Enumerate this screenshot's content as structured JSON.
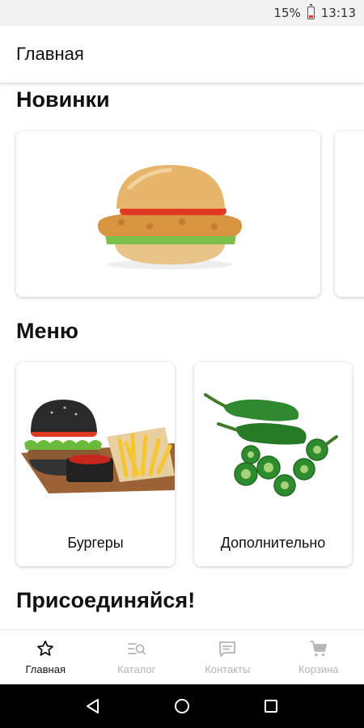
{
  "status_bar": {
    "battery_percent": "15%",
    "time": "13:13"
  },
  "app_bar": {
    "title": "Главная"
  },
  "sections": {
    "new": {
      "title": "Новинки"
    },
    "menu": {
      "title": "Меню",
      "items": [
        {
          "label": "Бургеры"
        },
        {
          "label": "Дополнительно"
        }
      ]
    },
    "join": {
      "title": "Присоединяйся!"
    }
  },
  "bottom_nav": {
    "items": [
      {
        "label": "Главная",
        "icon": "star-icon",
        "active": true
      },
      {
        "label": "Каталог",
        "icon": "catalog-search-icon",
        "active": false
      },
      {
        "label": "Контакты",
        "icon": "chat-icon",
        "active": false
      },
      {
        "label": "Корзина",
        "icon": "cart-icon",
        "active": false
      }
    ]
  },
  "colors": {
    "active": "#111111",
    "inactive": "#b5b5b5",
    "battery_low": "#e53935"
  }
}
